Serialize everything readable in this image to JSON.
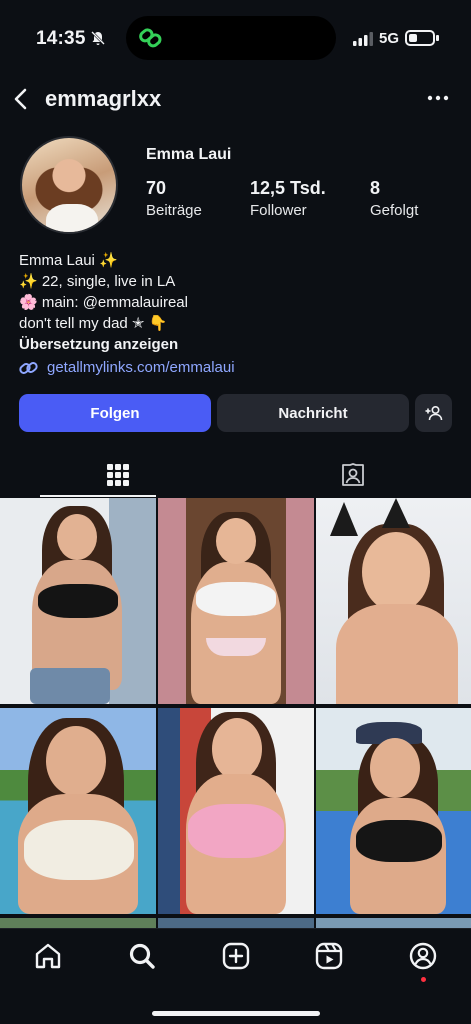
{
  "status_bar": {
    "time": "14:35",
    "network": "5G"
  },
  "header": {
    "username": "emmagrlxx"
  },
  "profile": {
    "display_name": "Emma Laui",
    "stats": [
      {
        "value": "70",
        "label": "Beiträge"
      },
      {
        "value": "12,5 Tsd.",
        "label": "Follower"
      },
      {
        "value": "8",
        "label": "Gefolgt"
      }
    ],
    "bio": [
      "Emma Laui ✨",
      "✨ 22, single, live in LA",
      "🌸 main: @emmalauireal",
      "don't tell my dad ✭ 👇"
    ],
    "translate_label": "Übersetzung anzeigen",
    "link": "getallmylinks.com/emmalaui"
  },
  "actions": {
    "follow_label": "Folgen",
    "message_label": "Nachricht"
  },
  "tabs": [
    "grid-icon",
    "tagged-icon"
  ],
  "colors": {
    "accent": "#4a5cf5",
    "link": "#8fa7ff",
    "background": "#0c0f14",
    "secondary_button": "#252830"
  },
  "nav": [
    "home-icon",
    "search-icon",
    "create-icon",
    "reels-icon",
    "profile-icon"
  ]
}
